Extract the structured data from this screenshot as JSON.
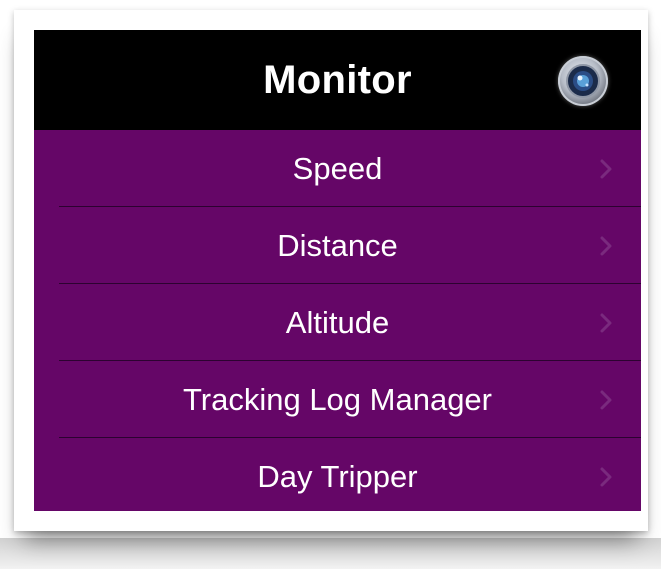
{
  "navbar": {
    "title": "Monitor",
    "right_icon": "camera-lens-icon"
  },
  "menu": {
    "items": [
      {
        "label": "Speed",
        "icon": "chevron-right-icon"
      },
      {
        "label": "Distance",
        "icon": "chevron-right-icon"
      },
      {
        "label": "Altitude",
        "icon": "chevron-right-icon"
      },
      {
        "label": "Tracking Log Manager",
        "icon": "chevron-right-icon"
      },
      {
        "label": "Day Tripper",
        "icon": "chevron-right-icon"
      }
    ]
  },
  "colors": {
    "navbar_bg": "#000000",
    "list_bg": "#650667",
    "separator": "#2c0230",
    "text": "#ffffff"
  }
}
